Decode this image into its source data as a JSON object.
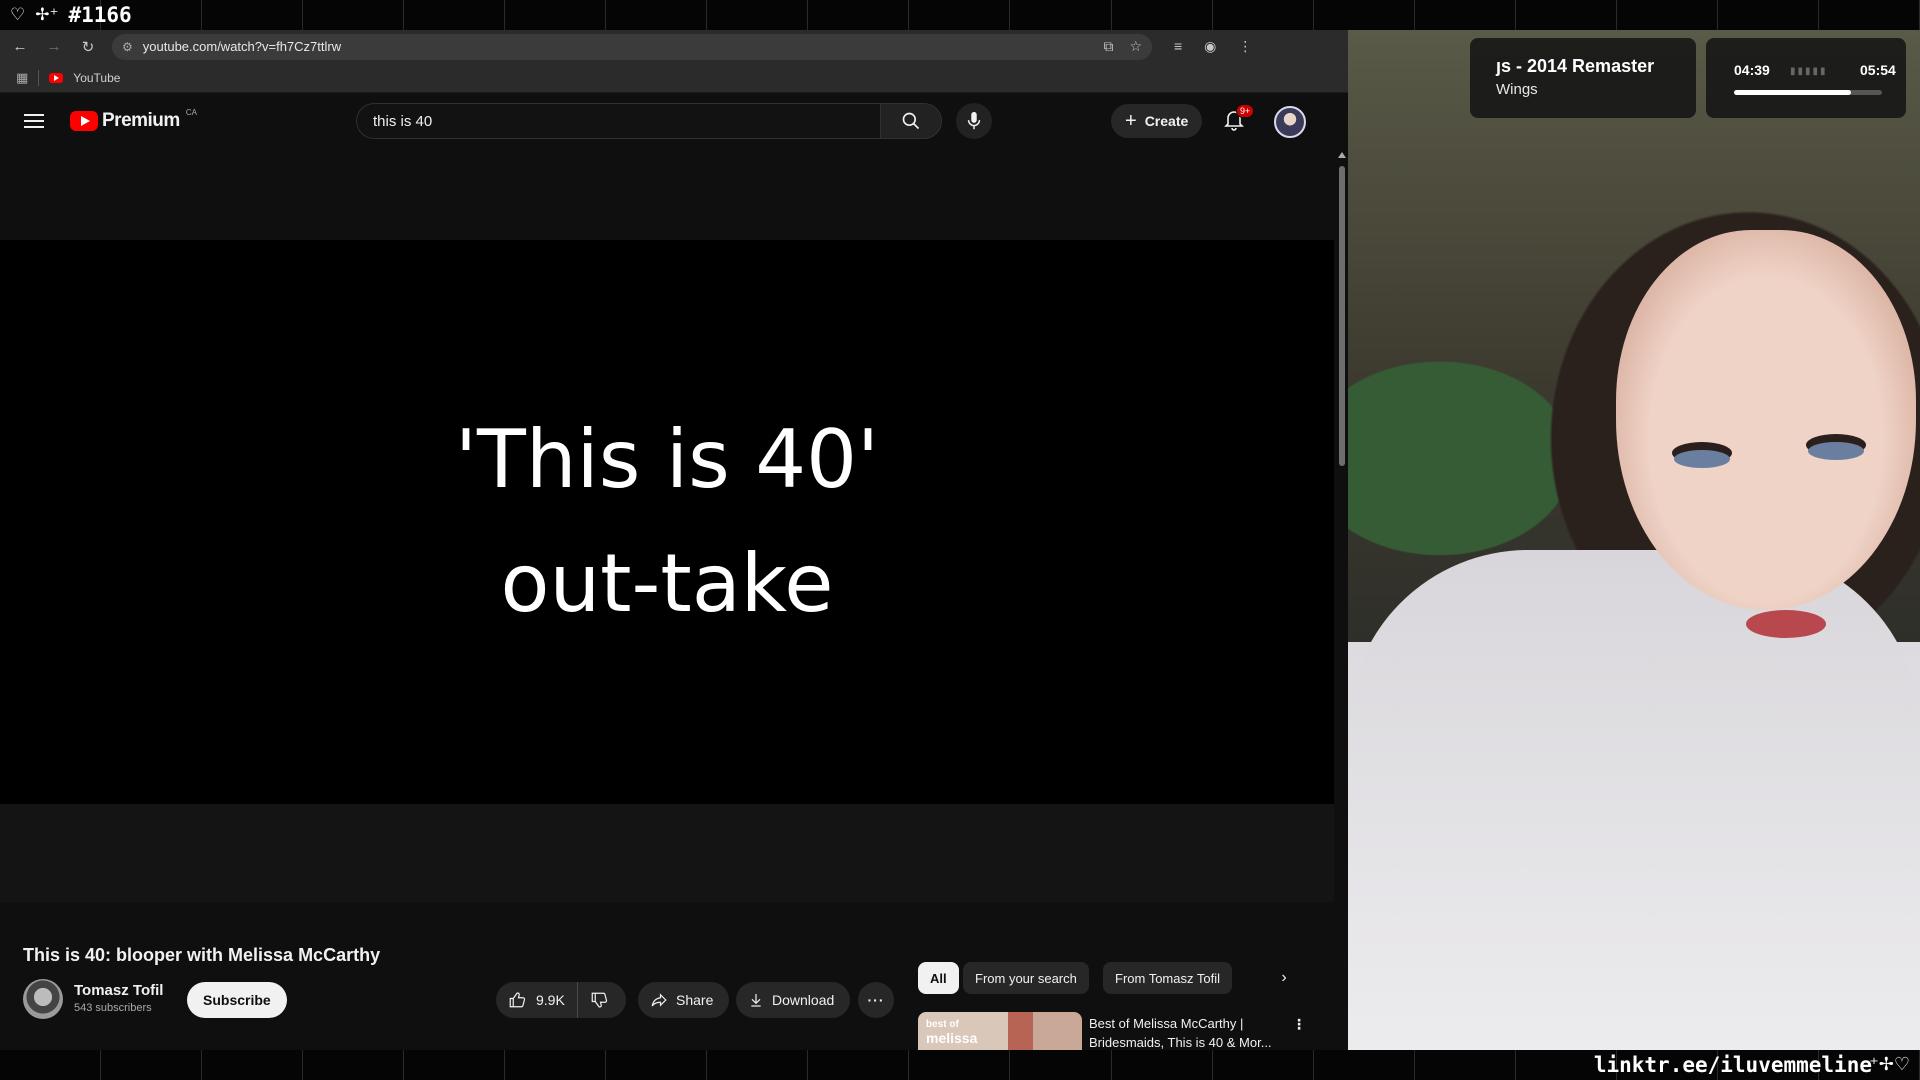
{
  "stream": {
    "counter": "#1166",
    "link": "linktr.ee/iluvemmeline"
  },
  "browser": {
    "url": "youtube.com/watch?v=fh7Cz7ttlrw",
    "bookmark_label": "YouTube"
  },
  "youtube": {
    "logo_text": "Premium",
    "region": "CA",
    "search_value": "this is 40",
    "create_label": "Create",
    "notifications_badge": "9+"
  },
  "player": {
    "overlay_line1": "'This is 40'",
    "overlay_line2": "out-take"
  },
  "video": {
    "title": "This is 40: blooper with Melissa McCarthy",
    "channel_name": "Tomasz Tofil",
    "subscribers": "543 subscribers",
    "subscribe_label": "Subscribe",
    "likes": "9.9K",
    "share_label": "Share",
    "download_label": "Download"
  },
  "sidebar": {
    "chips": [
      {
        "label": "All",
        "active": true
      },
      {
        "label": "From your search",
        "active": false
      },
      {
        "label": "From Tomasz Tofil",
        "active": false
      }
    ],
    "recommendation": {
      "thumb_tag_line1": "best of",
      "thumb_tag_line2": "melissa",
      "title": "Best of Melissa McCarthy | Bridesmaids, This is 40 & Mor..."
    }
  },
  "now_playing": {
    "song": "ȷs - 2014 Remaster",
    "artist": "Wings",
    "elapsed": "04:39",
    "duration": "05:54",
    "progress": 0.79
  },
  "colors": {
    "youtube_red": "#ff0000",
    "background": "#0f0f0f",
    "chip_bg": "#272727"
  }
}
